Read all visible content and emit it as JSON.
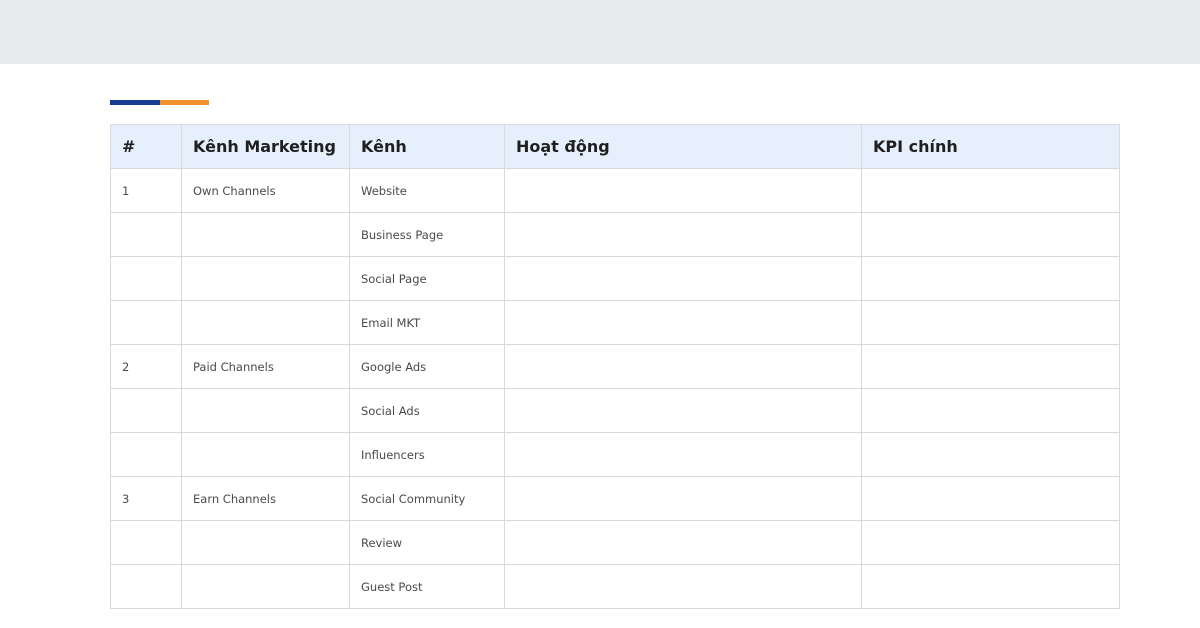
{
  "colors": {
    "top_band": "#e8eaec",
    "accent_blue": "#1a3a8f",
    "accent_orange": "#f0922b",
    "header_background": "#e6f0fc",
    "border": "#d6d9de"
  },
  "table": {
    "headers": [
      "#",
      "Kênh Marketing",
      "Kênh",
      "Hoạt động",
      "KPI chính"
    ],
    "rows": [
      {
        "num": "1",
        "group": "Own Channels",
        "channel": "Website",
        "activity": "",
        "kpi": ""
      },
      {
        "num": "",
        "group": "",
        "channel": "Business Page",
        "activity": "",
        "kpi": ""
      },
      {
        "num": "",
        "group": "",
        "channel": "Social Page",
        "activity": "",
        "kpi": ""
      },
      {
        "num": "",
        "group": "",
        "channel": "Email MKT",
        "activity": "",
        "kpi": ""
      },
      {
        "num": "2",
        "group": "Paid Channels",
        "channel": "Google Ads",
        "activity": "",
        "kpi": ""
      },
      {
        "num": "",
        "group": "",
        "channel": "Social Ads",
        "activity": "",
        "kpi": ""
      },
      {
        "num": "",
        "group": "",
        "channel": "Influencers",
        "activity": "",
        "kpi": ""
      },
      {
        "num": "3",
        "group": "Earn Channels",
        "channel": "Social Community",
        "activity": "",
        "kpi": ""
      },
      {
        "num": "",
        "group": "",
        "channel": "Review",
        "activity": "",
        "kpi": ""
      },
      {
        "num": "",
        "group": "",
        "channel": "Guest Post",
        "activity": "",
        "kpi": ""
      }
    ]
  }
}
